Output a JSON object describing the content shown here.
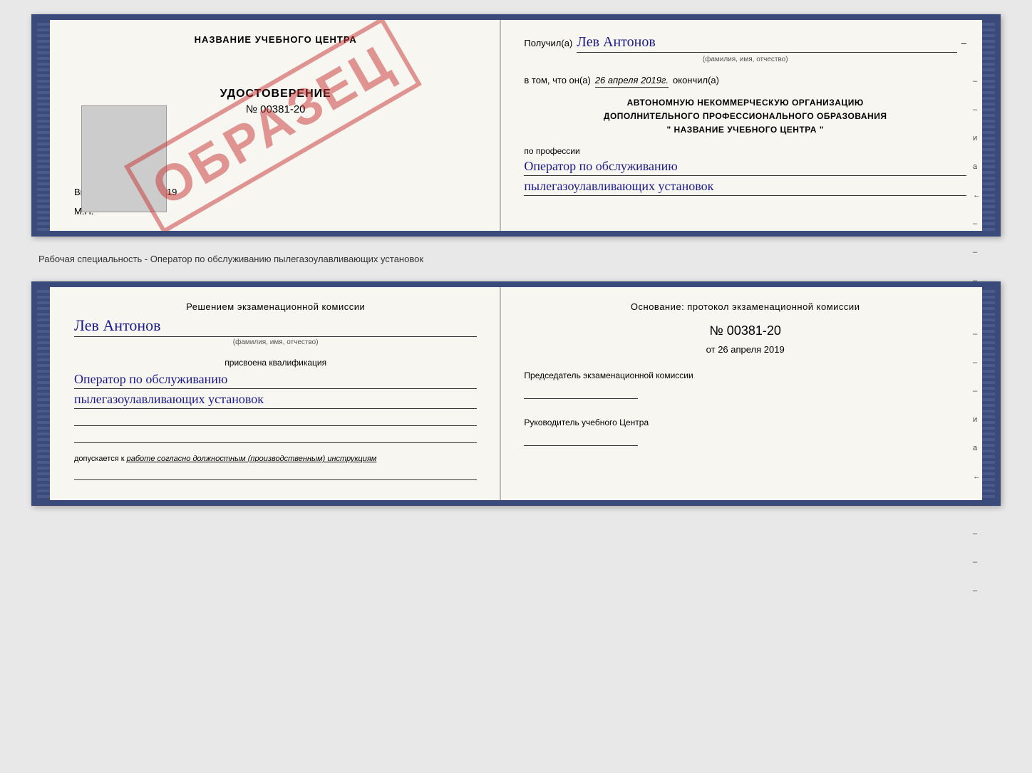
{
  "diploma": {
    "left": {
      "center_title": "НАЗВАНИЕ УЧЕБНОГО ЦЕНТРА",
      "udostoverenie_label": "УДОСТОВЕРЕНИЕ",
      "number": "№ 00381-20",
      "vydano_label": "Выдано",
      "vydano_date": "26 апреля 2019",
      "mp_label": "М.П.",
      "stamp_text": "ОБРАЗЕЦ"
    },
    "right": {
      "poluchil_label": "Получил(а)",
      "recipient_name": "Лев Антонов",
      "fio_hint": "(фамилия, имя, отчество)",
      "dash": "–",
      "vtom_label": "в том, что он(а)",
      "completion_date": "26 апреля 2019г.",
      "okonchil_label": "окончил(а)",
      "org_line1": "АВТОНОМНУЮ НЕКОММЕРЧЕСКУЮ ОРГАНИЗАЦИЮ",
      "org_line2": "ДОПОЛНИТЕЛЬНОГО ПРОФЕССИОНАЛЬНОГО ОБРАЗОВАНИЯ",
      "org_line3": "\"  НАЗВАНИЕ УЧЕБНОГО ЦЕНТРА  \"",
      "po_professii_label": "по профессии",
      "profession_line1": "Оператор по обслуживанию",
      "profession_line2": "пылегазоулавливающих установок",
      "side_labels": [
        "–",
        "–",
        "и",
        "а",
        "←",
        "–",
        "–",
        "–",
        "–"
      ]
    }
  },
  "separator": {
    "text": "Рабочая специальность - Оператор по обслуживанию пылегазоулавливающих установок"
  },
  "bottom_cert": {
    "left": {
      "resheniem_label": "Решением экзаменационной комиссии",
      "name": "Лев Антонов",
      "fio_hint": "(фамилия, имя, отчество)",
      "prisvoena_label": "присвоена квалификация",
      "qualification_line1": "Оператор по обслуживанию",
      "qualification_line2": "пылегазоулавливающих установок",
      "dopuskaetsya_prefix": "допускается к",
      "dopuskaetsya_italic": "работе согласно должностным (производственным) инструкциям"
    },
    "right": {
      "osnovanie_label": "Основание: протокол экзаменационной комиссии",
      "protocol_number": "№  00381-20",
      "ot_label": "от",
      "protocol_date": "26 апреля 2019",
      "predsedatel_label": "Председатель экзаменационной комиссии",
      "rukovoditel_label": "Руководитель учебного Центра",
      "side_labels": [
        "–",
        "–",
        "–",
        "и",
        "а",
        "←",
        "–",
        "–",
        "–",
        "–"
      ]
    }
  }
}
